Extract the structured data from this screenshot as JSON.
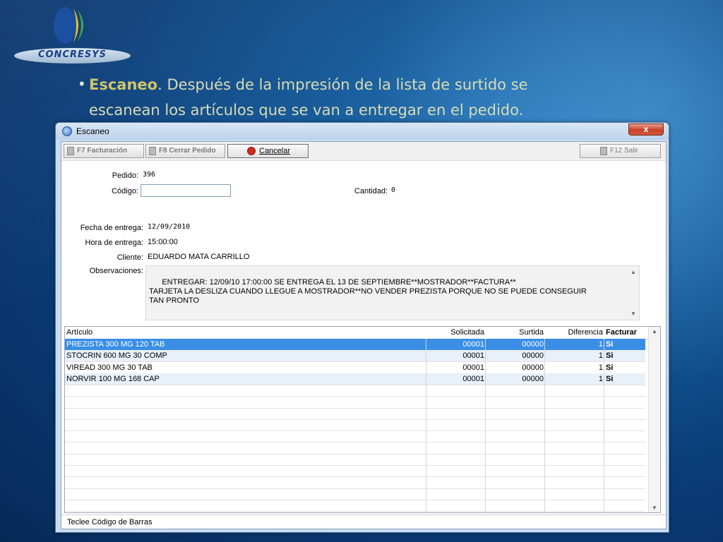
{
  "slide": {
    "logo_text": "CONCRESYS",
    "bullet_strong": "Escaneo",
    "bullet_rest": ". Después de la impresión de la lista de surtido se escanean los artículos que se van a entregar en el pedido."
  },
  "window": {
    "title": "Escaneo",
    "close_glyph": "x"
  },
  "toolbar": {
    "facturacion": "F7  Facturación",
    "cerrar_pedido": "F8 Cerrar Pedido",
    "cancelar": "Cancelar",
    "salir": "F12  Salir"
  },
  "form": {
    "pedido_label": "Pedido:",
    "pedido_value": "396",
    "codigo_label": "Código:",
    "codigo_value": "",
    "cantidad_label": "Cantidad:",
    "cantidad_value": "0",
    "fecha_label": "Fecha de entrega:",
    "fecha_value": "12/09/2010",
    "hora_label": "Hora de entrega:",
    "hora_value": "15:00:00",
    "cliente_label": "Cliente:",
    "cliente_value": "EDUARDO MATA CARRILLO",
    "obs_label": "Observaciones:",
    "obs_value": "ENTREGAR: 12/09/10 17:00:00 SE ENTREGA EL 13 DE SEPTIEMBRE**MOSTRADOR**FACTURA**\nTARJETA LA DESLIZA CUANDO LLEGUE A MOSTRADOR**NO VENDER PREZISTA PORQUE NO SE PUEDE CONSEGUIR\nTAN PRONTO"
  },
  "grid": {
    "headers": [
      "Artículo",
      "Solicitada",
      "Surtida",
      "Diferencia",
      "Facturar"
    ],
    "rows": [
      [
        "PREZISTA 300 MG 120 TAB",
        "00001",
        "00000",
        "1",
        "Si"
      ],
      [
        "STOCRIN 600 MG 30 COMP",
        "00001",
        "00000",
        "1",
        "Si"
      ],
      [
        "VIREAD 300 MG 30 TAB",
        "00001",
        "00000",
        "1",
        "Si"
      ],
      [
        "NORVIR 100 MG 168 CAP",
        "00001",
        "00000",
        "1",
        "Si"
      ]
    ],
    "selected_row": 0
  },
  "status": "Teclee Código de Barras"
}
